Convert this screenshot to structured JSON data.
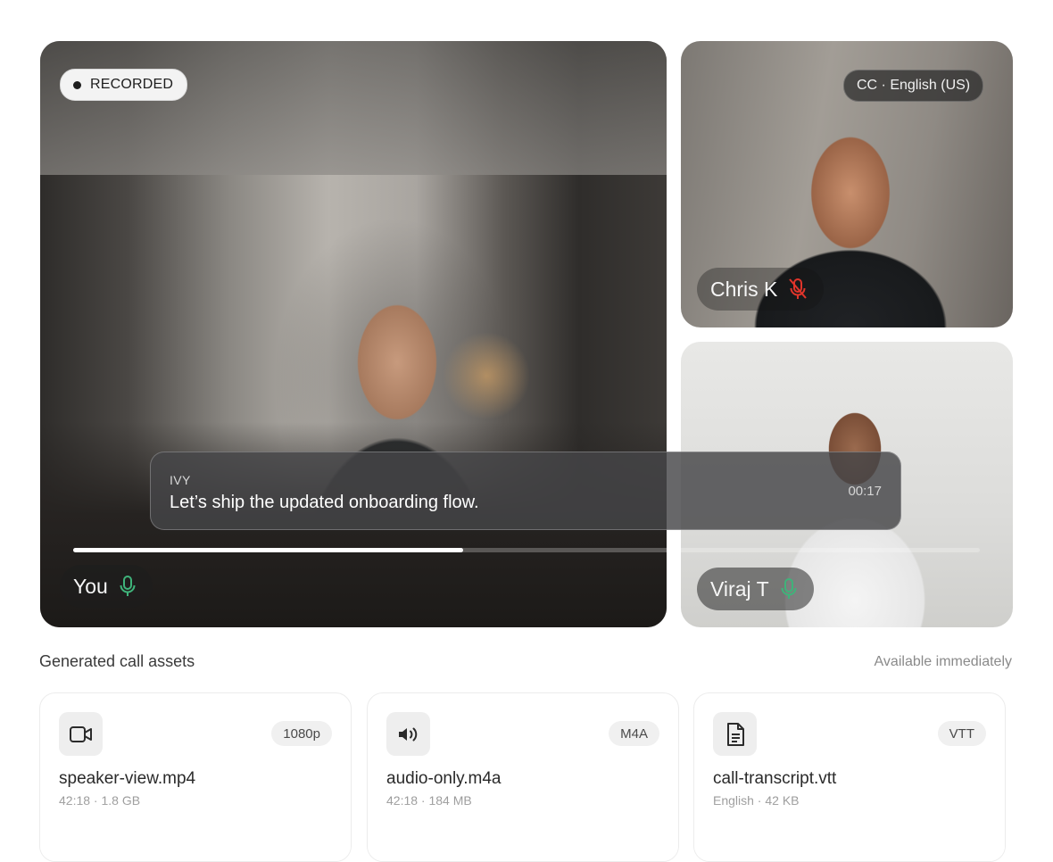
{
  "recording": {
    "label": "RECORDED"
  },
  "captions_setting": {
    "label": "CC · English (US)"
  },
  "participants": [
    {
      "name": "You",
      "mic": "on"
    },
    {
      "name": "Chris K",
      "mic": "muted"
    },
    {
      "name": "Viraj T",
      "mic": "on"
    }
  ],
  "live_caption": {
    "speaker": "IVY",
    "text": "Let’s ship the updated onboarding flow.",
    "timestamp": "00:17"
  },
  "playback": {
    "progress": 0.43
  },
  "assets_section": {
    "title": "Generated call assets",
    "note": "Available immediately",
    "items": [
      {
        "icon": "video-icon",
        "badge": "1080p",
        "filename": "speaker-view.mp4",
        "meta": "42:18 · 1.8 GB"
      },
      {
        "icon": "audio-icon",
        "badge": "M4A",
        "filename": "audio-only.m4a",
        "meta": "42:18 · 184 MB"
      },
      {
        "icon": "document-icon",
        "badge": "VTT",
        "filename": "call-transcript.vtt",
        "meta": "English · 42 KB"
      }
    ]
  },
  "colors": {
    "mic_on": "#3fb37a",
    "mic_muted": "#e0352b"
  }
}
